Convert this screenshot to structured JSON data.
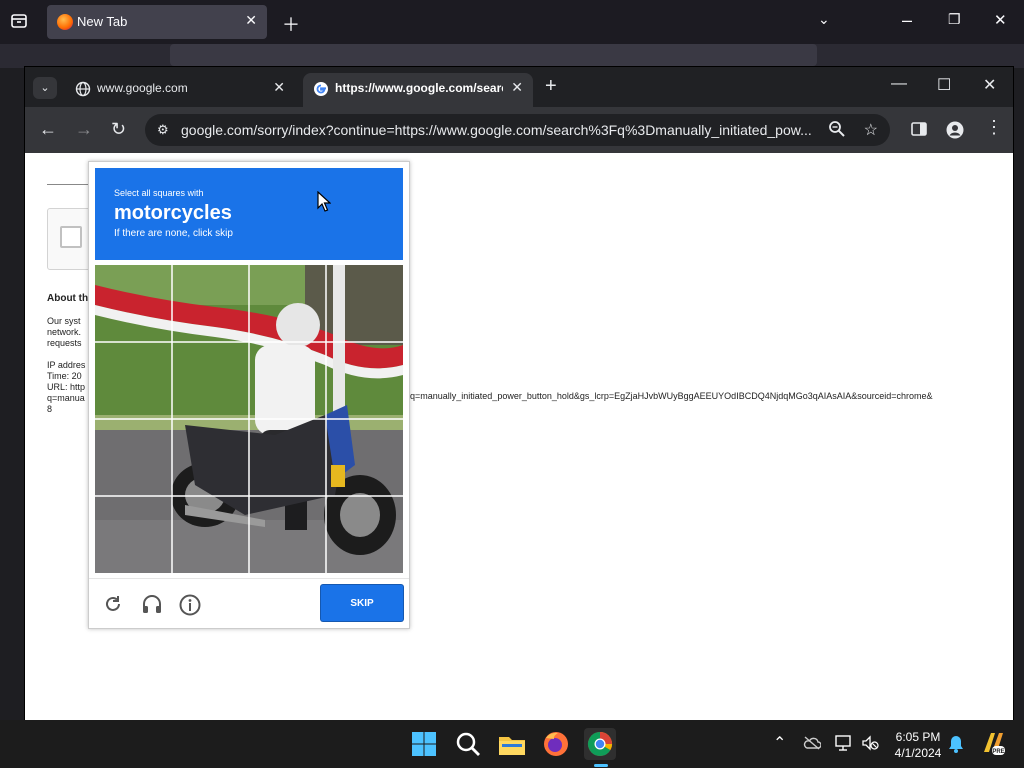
{
  "firefox": {
    "tab_title": "New Tab"
  },
  "chrome": {
    "tabs": [
      {
        "title": "www.google.com"
      },
      {
        "title": "https://www.google.com/search?q=manually_initiated"
      }
    ],
    "address": "google.com/sorry/index?continue=https://www.google.com/search%3Fq%3Dmanually_initiated_pow..."
  },
  "page": {
    "about_heading": "About th",
    "body_text": "Our syst\nnetwork.\nrequests\n\nIP addres\nTime: 20\nURL: http\nq=manua\n8",
    "url_tail": "oq=manually_initiated_power_button_hold&gs_lcrp=EgZjaHJvbWUyBggAEEUYOdIBCDQ4NjdqMGo3qAIAsAIA&sourceid=chrome&"
  },
  "captcha": {
    "instruction_line1": "Select all squares with",
    "target_object": "motorcycles",
    "instruction_line3": "If there are none, click skip",
    "skip_label": "SKIP",
    "grid": "4x4",
    "header_color": "#1a73e8"
  },
  "taskbar": {
    "time": "6:05 PM",
    "date": "4/1/2024",
    "apps": [
      "windows-start-icon",
      "search-icon",
      "file-explorer-icon",
      "firefox-icon",
      "chrome-icon"
    ]
  }
}
